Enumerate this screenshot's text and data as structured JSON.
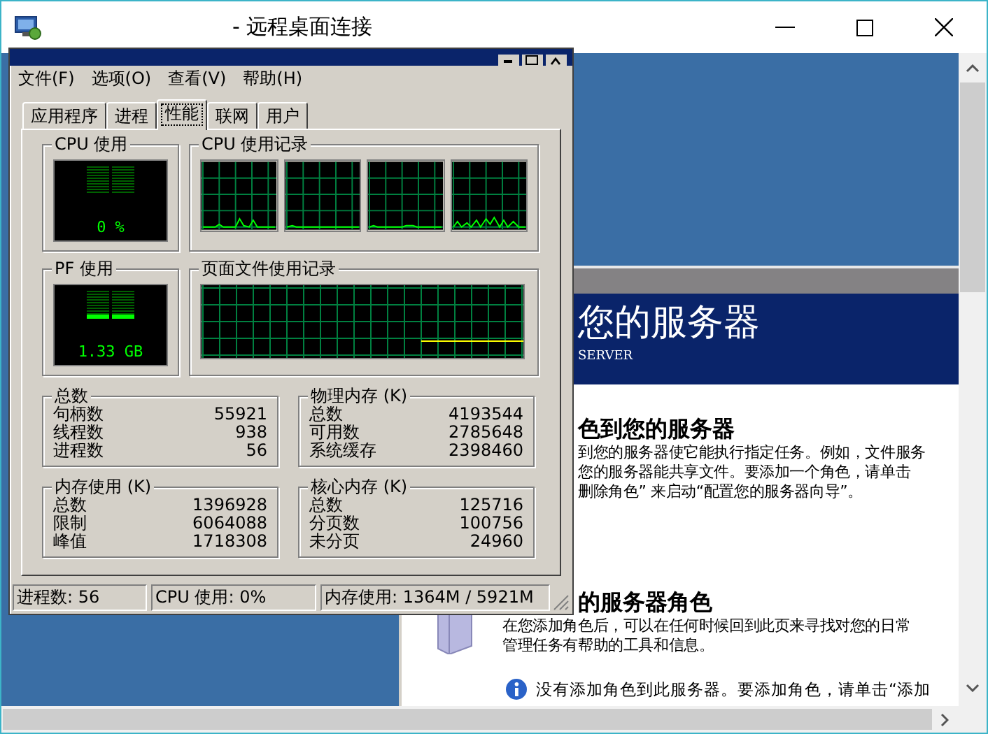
{
  "window": {
    "title": "- 远程桌面连接"
  },
  "task_manager": {
    "menu": [
      "文件(F)",
      "选项(O)",
      "查看(V)",
      "帮助(H)"
    ],
    "tabs": [
      {
        "label": "应用程序",
        "selected": false
      },
      {
        "label": "进程",
        "selected": false
      },
      {
        "label": "性能",
        "selected": true
      },
      {
        "label": "联网",
        "selected": false
      },
      {
        "label": "用户",
        "selected": false
      }
    ],
    "cpu_usage": {
      "title": "CPU 使用",
      "reading": "0 %",
      "level": 0
    },
    "cpu_history": {
      "title": "CPU 使用记录"
    },
    "pf_usage": {
      "title": "PF 使用",
      "reading": "1.33 GB",
      "level": 0.15
    },
    "pf_history": {
      "title": "页面文件使用记录"
    },
    "groups": [
      {
        "title": "总数",
        "rows": [
          {
            "label": "句柄数",
            "value": "55921"
          },
          {
            "label": "线程数",
            "value": "938"
          },
          {
            "label": "进程数",
            "value": "56"
          }
        ]
      },
      {
        "title": "物理内存 (K)",
        "rows": [
          {
            "label": "总数",
            "value": "4193544"
          },
          {
            "label": "可用数",
            "value": "2785648"
          },
          {
            "label": "系统缓存",
            "value": "2398460"
          }
        ]
      },
      {
        "title": "内存使用 (K)",
        "rows": [
          {
            "label": "总数",
            "value": "1396928"
          },
          {
            "label": "限制",
            "value": "6064088"
          },
          {
            "label": "峰值",
            "value": "1718308"
          }
        ]
      },
      {
        "title": "核心内存 (K)",
        "rows": [
          {
            "label": "总数",
            "value": "125716"
          },
          {
            "label": "分页数",
            "value": "100756"
          },
          {
            "label": "未分页",
            "value": "24960"
          }
        ]
      }
    ],
    "status_bar": [
      "进程数: 56",
      "CPU 使用: 0%",
      "内存使用: 1364M / 5921M"
    ]
  },
  "server_window": {
    "banner_title": "您的服务器",
    "banner_subtitle": "SERVER",
    "sections": [
      {
        "heading": "色到您的服务器",
        "lines": [
          "到您的服务器使它能执行指定任务。例如，文件服务",
          "您的服务器能共享文件。要添加一个角色，请单击",
          "删除角色” 来启动“配置您的服务器向导”。"
        ]
      },
      {
        "heading": "的服务器角色",
        "lines": [
          "在您添加角色后，可以在任何时候回到此页来寻找对您的日常",
          "管理任务有帮助的工具和信息。"
        ]
      }
    ],
    "info_note": "没有添加角色到此服务器。要添加角色，请单击“添加"
  }
}
